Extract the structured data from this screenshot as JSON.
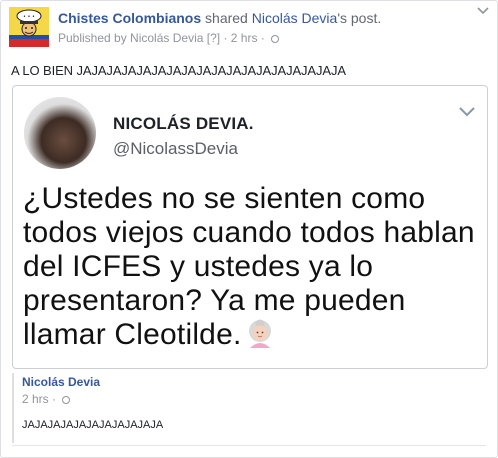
{
  "header": {
    "page_name": "Chistes Colombianos",
    "shared_text": " shared ",
    "original_author": "Nicolás Devia",
    "post_suffix": "'s post.",
    "published_by": "Published by Nicolás Devia",
    "badge": "[?]",
    "time": "2 hrs",
    "separator": "·"
  },
  "post": {
    "text": "A LO BIEN JAJAJAJAJAJAJAJAJAJAJAJAJAJAJAJAJAJA"
  },
  "tweet": {
    "name": "NICOLÁS DEVIA.",
    "handle": "@NicolassDevia",
    "body": "¿Ustedes no se sienten como todos viejos cuando todos hablan del ICFES y ustedes ya lo presentaron? Ya me pueden llamar Cleotilde."
  },
  "shared_post": {
    "author": "Nicolás Devia",
    "time": "2 hrs",
    "separator": "·",
    "text": "JAJAJAJAJAJAJAJAJAJAJA"
  },
  "icons": [
    "page-avatar-icon",
    "chevron-down-icon",
    "privacy-globe-icon",
    "old-woman-emoji-icon"
  ],
  "colors": {
    "link": "#365899",
    "muted": "#90949c",
    "border": "#dddfe2",
    "avatar_bg": "#f2d64b"
  }
}
